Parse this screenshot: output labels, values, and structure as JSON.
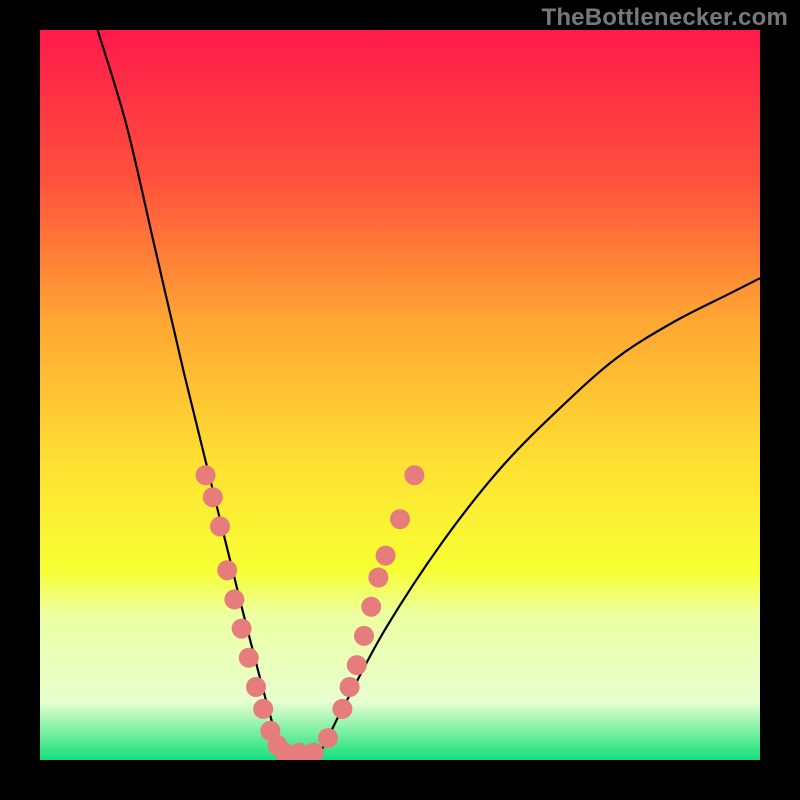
{
  "watermark": "TheBottlenecker.com",
  "chart_data": {
    "type": "line",
    "title": "",
    "xlabel": "",
    "ylabel": "",
    "xlim": [
      0,
      100
    ],
    "ylim": [
      0,
      100
    ],
    "gradient_stops": [
      {
        "pct": 0,
        "color": "#ff1a4b"
      },
      {
        "pct": 20,
        "color": "#ff4f3d"
      },
      {
        "pct": 40,
        "color": "#ffa733"
      },
      {
        "pct": 60,
        "color": "#ffe233"
      },
      {
        "pct": 74,
        "color": "#f7ff33"
      },
      {
        "pct": 80,
        "color": "#ecffa0"
      },
      {
        "pct": 92,
        "color": "#e8ffd0"
      },
      {
        "pct": 100,
        "color": "#14e07a"
      }
    ],
    "series": [
      {
        "name": "bottleneck-curve",
        "desc": "V-shaped bottleneck curve; minimum near x≈34; left branch rises sharply toward top, right branch rises gently.",
        "points": [
          {
            "x": 8,
            "y": 100
          },
          {
            "x": 12,
            "y": 87
          },
          {
            "x": 16,
            "y": 70
          },
          {
            "x": 20,
            "y": 53
          },
          {
            "x": 24,
            "y": 37
          },
          {
            "x": 28,
            "y": 21
          },
          {
            "x": 32,
            "y": 6
          },
          {
            "x": 34,
            "y": 0
          },
          {
            "x": 38,
            "y": 0
          },
          {
            "x": 42,
            "y": 7
          },
          {
            "x": 48,
            "y": 18
          },
          {
            "x": 56,
            "y": 30
          },
          {
            "x": 64,
            "y": 40
          },
          {
            "x": 72,
            "y": 48
          },
          {
            "x": 80,
            "y": 55
          },
          {
            "x": 88,
            "y": 60
          },
          {
            "x": 96,
            "y": 64
          },
          {
            "x": 100,
            "y": 66
          }
        ]
      }
    ],
    "markers": {
      "desc": "Salmon dot markers clustered on the lower slopes of both branches",
      "color": "#e77c7c",
      "radius": 10,
      "points": [
        {
          "x": 23,
          "y": 39
        },
        {
          "x": 24,
          "y": 36
        },
        {
          "x": 25,
          "y": 32
        },
        {
          "x": 26,
          "y": 26
        },
        {
          "x": 27,
          "y": 22
        },
        {
          "x": 28,
          "y": 18
        },
        {
          "x": 29,
          "y": 14
        },
        {
          "x": 30,
          "y": 10
        },
        {
          "x": 31,
          "y": 7
        },
        {
          "x": 32,
          "y": 4
        },
        {
          "x": 33,
          "y": 2
        },
        {
          "x": 34,
          "y": 1
        },
        {
          "x": 36,
          "y": 1
        },
        {
          "x": 38,
          "y": 1
        },
        {
          "x": 40,
          "y": 3
        },
        {
          "x": 42,
          "y": 7
        },
        {
          "x": 43,
          "y": 10
        },
        {
          "x": 44,
          "y": 13
        },
        {
          "x": 45,
          "y": 17
        },
        {
          "x": 46,
          "y": 21
        },
        {
          "x": 47,
          "y": 25
        },
        {
          "x": 48,
          "y": 28
        },
        {
          "x": 50,
          "y": 33
        },
        {
          "x": 52,
          "y": 39
        }
      ]
    }
  }
}
